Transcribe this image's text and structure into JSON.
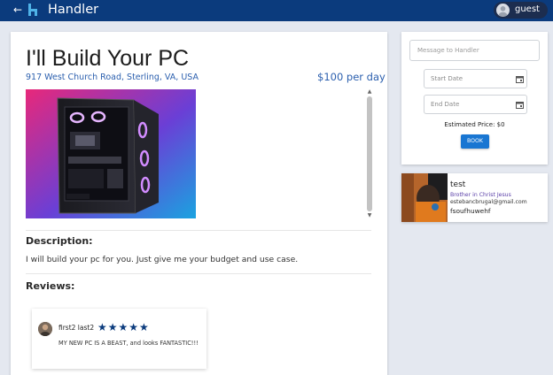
{
  "header": {
    "back_glyph": "←",
    "brand": "Handler",
    "user_name": "guest",
    "bar_color": "#0b3b7d"
  },
  "listing": {
    "title": "I'll Build Your PC",
    "address": "917 West Church Road, Sterling, VA, USA",
    "price": "$100 per day",
    "description_heading": "Description:",
    "description": "I will build your pc for you. Just give me your budget and use case.",
    "reviews_heading": "Reviews:"
  },
  "reviews": [
    {
      "name": "first2 last2",
      "stars": "★★★★★",
      "rating": 5,
      "text": "MY NEW PC IS A BEAST, and looks FANTASTIC!!!"
    }
  ],
  "booking": {
    "message_placeholder": "Message to Handler",
    "start_placeholder": "Start Date",
    "end_placeholder": "End Date",
    "estimated_price": "Estimated Price: $0",
    "book_label": "BOOK",
    "button_color": "#1976d2"
  },
  "handler": {
    "name": "test",
    "tagline": "Brother in Christ Jesus",
    "email": "estebancbrugal@gmail.com",
    "extra": "fsoufhuwehf"
  },
  "icons": {
    "calendar": "calendar-icon",
    "star": "star-icon"
  }
}
